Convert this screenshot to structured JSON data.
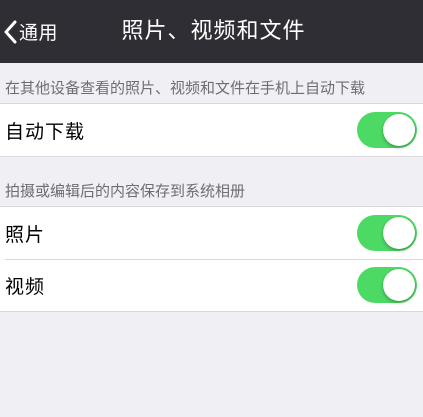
{
  "nav": {
    "back_label": "通用",
    "title": "照片、视频和文件"
  },
  "sections": [
    {
      "header": "在其他设备查看的照片、视频和文件在手机上自动下载",
      "items": [
        {
          "label": "自动下载",
          "on": true
        }
      ]
    },
    {
      "header": "拍摄或编辑后的内容保存到系统相册",
      "items": [
        {
          "label": "照片",
          "on": true
        },
        {
          "label": "视频",
          "on": true
        }
      ]
    }
  ],
  "colors": {
    "nav_background": "#2f2e34",
    "page_background": "#efeff4",
    "switch_on": "#4cd964",
    "section_header_text": "#6d6d72"
  },
  "icons": {
    "back": "chevron-left-icon"
  }
}
